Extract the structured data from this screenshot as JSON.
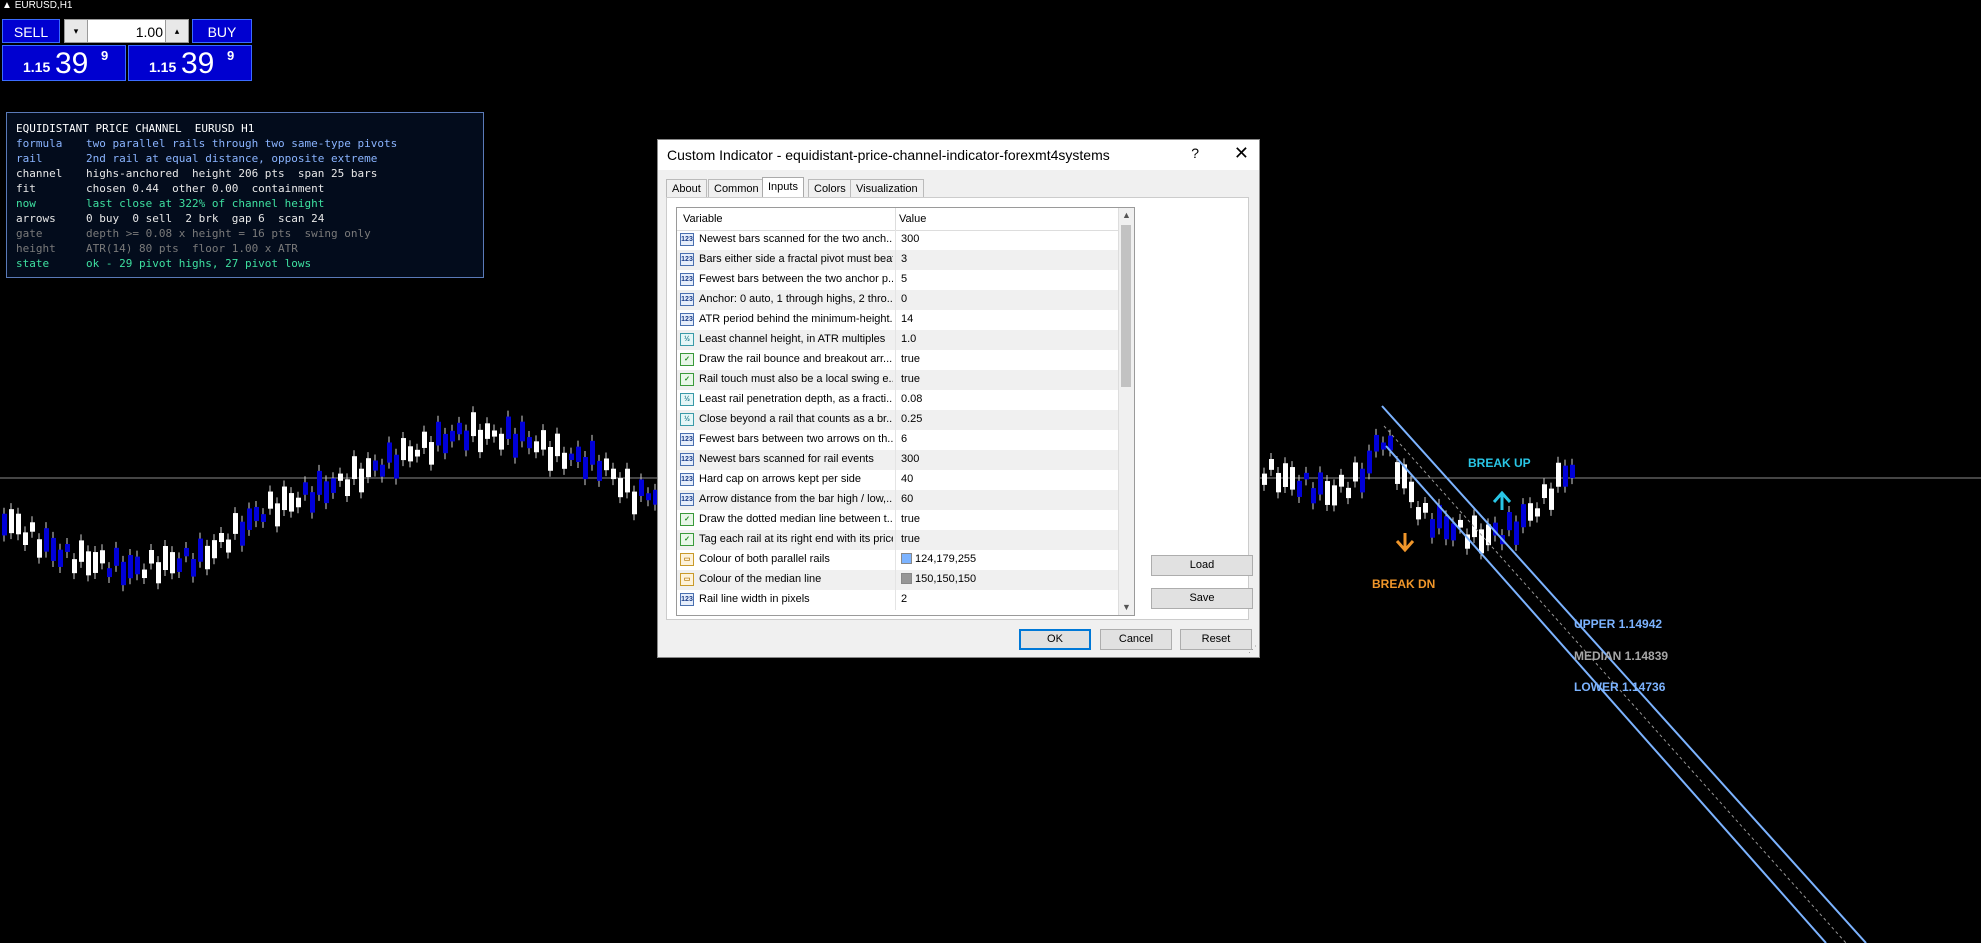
{
  "chart": {
    "symbol_title": "EURUSD,H1",
    "labels": {
      "break_up": "BREAK UP",
      "break_dn": "BREAK DN",
      "upper": "UPPER 1.14942",
      "median": "MEDIAN 1.14839",
      "lower": "LOWER 1.14736"
    },
    "colors": {
      "rails": "#7cb3ff",
      "median": "#969696",
      "bull_candle": "#ffffff",
      "bear_candle": "#0000d8",
      "break_up": "#29c6e6",
      "break_dn": "#f0962a"
    }
  },
  "trade_panel": {
    "sell_label": "SELL",
    "buy_label": "BUY",
    "lot_value": "1.00",
    "dec_glyph": "▾",
    "inc_glyph": "▴",
    "sell_price": {
      "prefix": "1.15",
      "big": "39",
      "sup": "9"
    },
    "buy_price": {
      "prefix": "1.15",
      "big": "39",
      "sup": "9"
    }
  },
  "info_panel": {
    "title": "EQUIDISTANT PRICE CHANNEL  EURUSD H1",
    "rows": [
      {
        "key": "formula",
        "value": "two parallel rails through two same-type pivots",
        "color": "#8ab4ff"
      },
      {
        "key": "rail",
        "value": "2nd rail at equal distance, opposite extreme",
        "color": "#8ab4ff"
      },
      {
        "key": "channel",
        "value": "highs-anchored  height 206 pts  span 25 bars",
        "color": "#e8e8e8"
      },
      {
        "key": "fit",
        "value": "chosen 0.44  other 0.00  containment",
        "color": "#e8e8e8"
      },
      {
        "key": "now",
        "value": "last close at 322% of channel height",
        "color": "#3ee0a0"
      },
      {
        "key": "arrows",
        "value": "0 buy  0 sell  2 brk  gap 6  scan 24",
        "color": "#e8e8e8"
      },
      {
        "key": "gate",
        "value": "depth >= 0.08 x height = 16 pts  swing only",
        "color": "#7a7a7a"
      },
      {
        "key": "height",
        "value": "ATR(14) 80 pts  floor 1.00 x ATR",
        "color": "#7a7a7a"
      },
      {
        "key": "state",
        "value": "ok - 29 pivot highs, 27 pivot lows",
        "color": "#3ee0a0"
      }
    ]
  },
  "dialog": {
    "title": "Custom Indicator - equidistant-price-channel-indicator-forexmt4systems",
    "help_glyph": "?",
    "close_glyph": "✕",
    "tabs": [
      "About",
      "Common",
      "Inputs",
      "Colors",
      "Visualization"
    ],
    "active_tab": "Inputs",
    "columns": {
      "variable": "Variable",
      "value": "Value"
    },
    "rows": [
      {
        "icon": "int",
        "variable": "Newest bars scanned for the two anch...",
        "value": "300"
      },
      {
        "icon": "int",
        "variable": "Bars either side a fractal pivot must beat",
        "value": "3"
      },
      {
        "icon": "int",
        "variable": "Fewest bars between the two anchor p...",
        "value": "5"
      },
      {
        "icon": "int",
        "variable": "Anchor: 0 auto, 1 through highs, 2 thro...",
        "value": "0"
      },
      {
        "icon": "int",
        "variable": "ATR period behind the minimum-height...",
        "value": "14"
      },
      {
        "icon": "dbl",
        "variable": "Least channel height, in ATR multiples",
        "value": "1.0"
      },
      {
        "icon": "bool",
        "variable": "Draw the rail bounce and breakout arr...",
        "value": "true"
      },
      {
        "icon": "bool",
        "variable": "Rail touch must also be a local swing e...",
        "value": "true"
      },
      {
        "icon": "dbl",
        "variable": "Least rail penetration depth, as a fracti...",
        "value": "0.08"
      },
      {
        "icon": "dbl",
        "variable": "Close beyond a rail that counts as a br...",
        "value": "0.25"
      },
      {
        "icon": "int",
        "variable": "Fewest bars between two arrows on th...",
        "value": "6"
      },
      {
        "icon": "int",
        "variable": "Newest bars scanned for rail events",
        "value": "300"
      },
      {
        "icon": "int",
        "variable": "Hard cap on arrows kept per side",
        "value": "40"
      },
      {
        "icon": "int",
        "variable": "Arrow distance from the bar high / low,...",
        "value": "60"
      },
      {
        "icon": "bool",
        "variable": "Draw the dotted median line between t...",
        "value": "true"
      },
      {
        "icon": "bool",
        "variable": "Tag each rail at its right end with its price",
        "value": "true"
      },
      {
        "icon": "clr",
        "variable": "Colour of both parallel rails",
        "value": "124,179,255",
        "swatch": "#7cb3ff"
      },
      {
        "icon": "clr",
        "variable": "Colour of the median line",
        "value": "150,150,150",
        "swatch": "#969696"
      },
      {
        "icon": "int",
        "variable": "Rail line width in pixels",
        "value": "2"
      }
    ],
    "buttons": {
      "load": "Load",
      "save": "Save",
      "ok": "OK",
      "cancel": "Cancel",
      "reset": "Reset"
    },
    "scroll_up_glyph": "▲",
    "scroll_down_glyph": "▼",
    "grip_glyph": "⋰"
  }
}
